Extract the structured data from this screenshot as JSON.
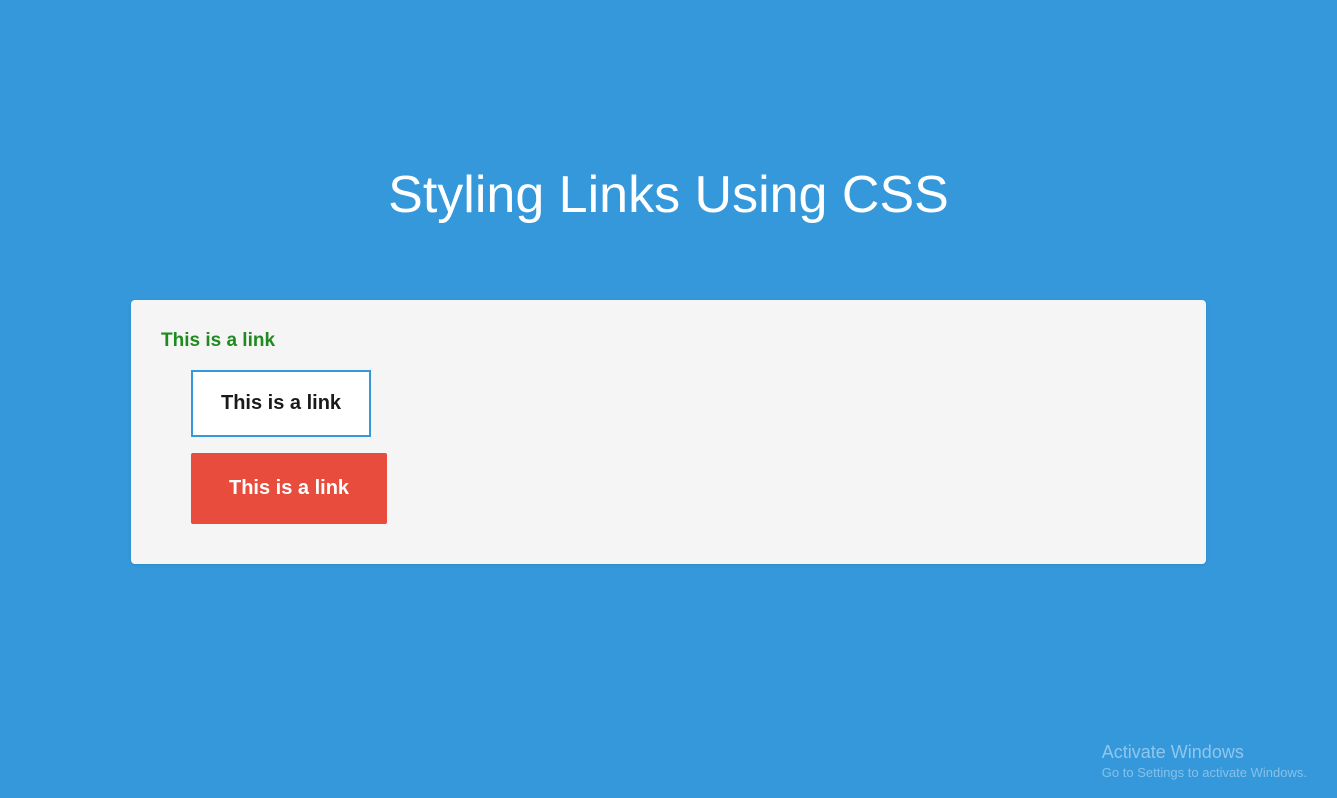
{
  "heading": "Styling Links Using CSS",
  "links": {
    "plain": "This is a link",
    "outlined": "This is a link",
    "filled": "This is a link"
  },
  "watermark": {
    "title": "Activate Windows",
    "subtitle": "Go to Settings to activate Windows."
  },
  "colors": {
    "background": "#3498db",
    "panel": "#f5f5f5",
    "linkPlain": "#1f8a1f",
    "linkOutlineBorder": "#3498db",
    "linkFilled": "#e74c3c"
  }
}
